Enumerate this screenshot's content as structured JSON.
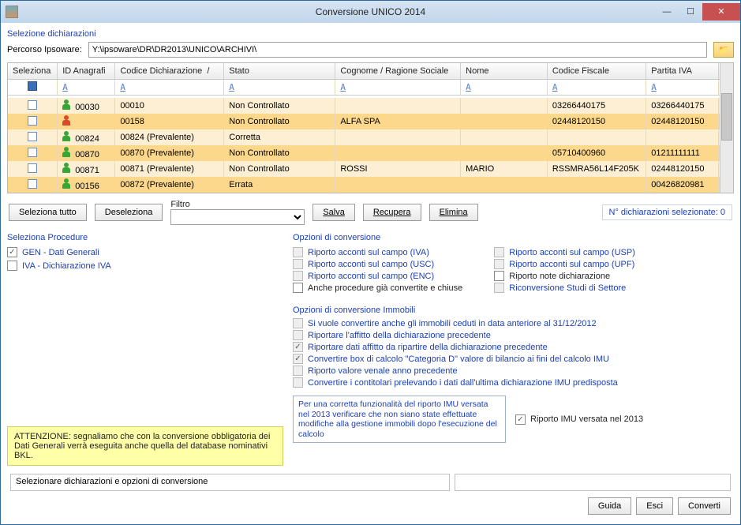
{
  "window": {
    "title": "Conversione UNICO 2014"
  },
  "section": {
    "selezione": "Selezione dichiarazioni",
    "percorso_label": "Percorso Ipsoware:",
    "percorso_value": "Y:\\ipsoware\\DR\\DR2013\\UNICO\\ARCHIVI\\"
  },
  "grid": {
    "headers": {
      "sel": "Seleziona",
      "idana": "ID Anagrafi",
      "codice": "Codice Dichiarazione",
      "stato": "Stato",
      "cognome": "Cognome / Ragione Sociale",
      "nome": "Nome",
      "cf": "Codice Fiscale",
      "piva": "Partita IVA"
    },
    "rows": [
      {
        "color": "#37a637",
        "idana": "00030",
        "codice": "00010",
        "stato": "Non Controllato",
        "cognome": "",
        "nome": "",
        "cf": "03266440175",
        "piva": "03266440175"
      },
      {
        "color": "#d94a2a",
        "idana": "",
        "codice": "00158",
        "stato": "Non Controllato",
        "cognome": "ALFA SPA",
        "nome": "",
        "cf": "02448120150",
        "piva": "02448120150"
      },
      {
        "color": "#37a637",
        "idana": "00824",
        "codice": "00824  (Prevalente)",
        "stato": "Corretta",
        "cognome": "",
        "nome": "",
        "cf": "",
        "piva": ""
      },
      {
        "color": "#37a637",
        "idana": "00870",
        "codice": "00870  (Prevalente)",
        "stato": "Non Controllato",
        "cognome": "",
        "nome": "",
        "cf": "05710400960",
        "piva": "01211111111"
      },
      {
        "color": "#37a637",
        "idana": "00871",
        "codice": "00871  (Prevalente)",
        "stato": "Non Controllato",
        "cognome": "ROSSI",
        "nome": "MARIO",
        "cf": "RSSMRA56L14F205K",
        "piva": "02448120150"
      },
      {
        "color": "#37a637",
        "idana": "00156",
        "codice": "00872  (Prevalente)",
        "stato": "Errata",
        "cognome": "",
        "nome": "",
        "cf": "",
        "piva": "00426820981"
      }
    ]
  },
  "buttons": {
    "seleziona_tutto": "Seleziona tutto",
    "deseleziona": "Deseleziona",
    "filtro_label": "Filtro",
    "salva": "Salva",
    "recupera": "Recupera",
    "elimina": "Elimina",
    "counter": "N° dichiarazioni selezionate: 0",
    "guida": "Guida",
    "esci": "Esci",
    "converti": "Converti"
  },
  "procedures": {
    "title": "Seleziona Procedure",
    "gen": "GEN - Dati Generali",
    "iva": "IVA - Dichiarazione IVA"
  },
  "opts": {
    "title": "Opzioni di conversione",
    "items": [
      "Riporto acconti sul campo (IVA)",
      "Riporto acconti sul campo (USC)",
      "Riporto acconti sul campo (ENC)",
      "Anche procedure già convertite e chiuse",
      "Riporto acconti sul campo (USP)",
      "Riporto acconti sul campo (UPF)",
      "Riporto note dichiarazione",
      "Riconversione Studi di Settore"
    ]
  },
  "immobili": {
    "title": "Opzioni di conversione Immobili",
    "items": [
      "Si vuole convertire anche gli immobili ceduti in data anteriore al 31/12/2012",
      "Riportare l'affitto della dichiarazione precedente",
      "Riportare dati affitto da ripartire della dichiarazione precedente",
      "Convertire box di calcolo \"Categoria D\" valore di bilancio ai fini del calcolo IMU",
      "Riporto valore venale anno precedente",
      "Convertire i contitolari prelevando i dati dall'ultima dichiarazione IMU predisposta"
    ],
    "note": "Per una corretta funzionalità del riporto IMU versata nel 2013 verificare che non siano state effettuate modifiche alla gestione immobili dopo l'esecuzione del calcolo",
    "riporto_imu": "Riporto IMU versata nel 2013"
  },
  "warn": "ATTENZIONE: segnaliamo che con la conversione obbligatoria dei Dati Generali verrà eseguita anche quella del database nominativi BKL.",
  "status": "Selezionare dichiarazioni e opzioni di conversione"
}
